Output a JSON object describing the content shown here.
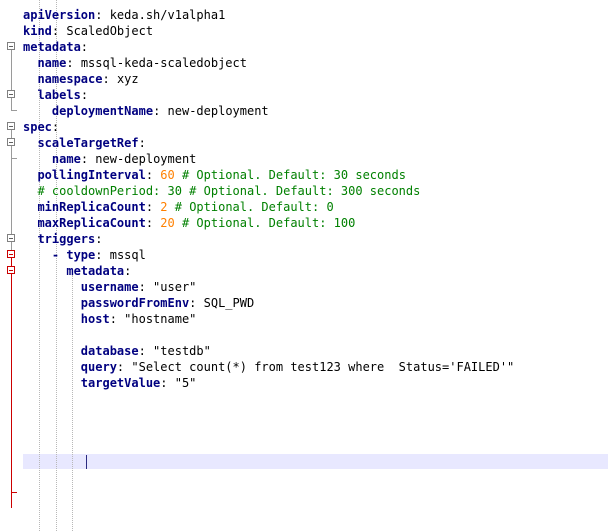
{
  "editor": {
    "language": "yaml",
    "colors": {
      "key": "#000080",
      "value": "#000000",
      "number": "#ff8000",
      "comment": "#008000",
      "current_line": "#e8e8ff",
      "fold_marker_active": "#cc0000"
    },
    "lines": [
      {
        "key": "apiVersion",
        "sep": ": ",
        "value": "keda.sh/v1alpha1"
      },
      {
        "key": "kind",
        "sep": ": ",
        "value": "ScaledObject"
      },
      {
        "key": "metadata",
        "sep": ":",
        "value": ""
      },
      {
        "key": "name",
        "sep": ": ",
        "value": "mssql-keda-scaledobject"
      },
      {
        "key": "namespace",
        "sep": ": ",
        "value": "xyz"
      },
      {
        "key": "labels",
        "sep": ":",
        "value": ""
      },
      {
        "key": "deploymentName",
        "sep": ": ",
        "value": "new-deployment"
      },
      {
        "key": "spec",
        "sep": ":",
        "value": ""
      },
      {
        "key": "scaleTargetRef",
        "sep": ":",
        "value": ""
      },
      {
        "key": "name",
        "sep": ": ",
        "value": "new-deployment"
      },
      {
        "key": "pollingInterval",
        "sep": ": ",
        "number": "60",
        "comment": " # Optional. Default: 30 seconds"
      },
      {
        "comment": "# cooldownPeriod: 30 # Optional. Default: 300 seconds"
      },
      {
        "key": "minReplicaCount",
        "sep": ": ",
        "number": "2",
        "comment": " # Optional. Default: 0"
      },
      {
        "key": "maxReplicaCount",
        "sep": ": ",
        "number": "20",
        "comment": " # Optional. Default: 100"
      },
      {
        "key": "triggers",
        "sep": ":",
        "value": ""
      },
      {
        "dash": "- ",
        "key": "type",
        "sep": ": ",
        "value": "mssql"
      },
      {
        "key": "metadata",
        "sep": ":",
        "value": ""
      },
      {
        "key": "username",
        "sep": ": ",
        "value": "\"user\""
      },
      {
        "key": "passwordFromEnv",
        "sep": ": ",
        "value": "SQL_PWD"
      },
      {
        "key": "host",
        "sep": ": ",
        "value": "\"hostname\""
      },
      {
        "key": "database",
        "sep": ": ",
        "value": "\"testdb\""
      },
      {
        "key": "query",
        "sep": ": ",
        "value": "\"Select count(*) from test123 where  Status='FAILED'\""
      },
      {
        "key": "targetValue",
        "sep": ": ",
        "value": "\"5\""
      }
    ]
  }
}
